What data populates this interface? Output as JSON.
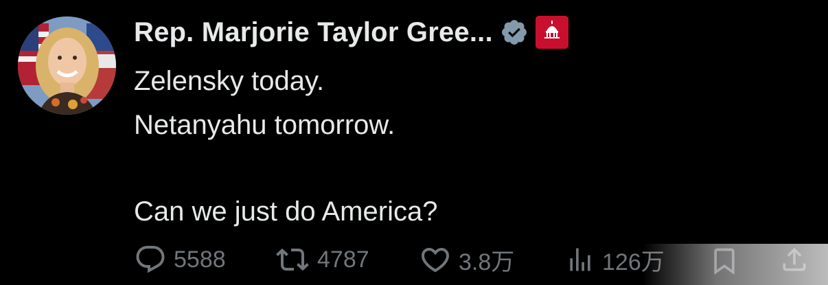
{
  "author": {
    "display_name": "Rep. Marjorie Taylor Gree...",
    "verified_icon": "verified-badge-icon",
    "affiliation_icon": "house-gop-badge-icon",
    "affiliation_text": "HOUSE GOP"
  },
  "tweet": {
    "lines": [
      "Zelensky today.",
      "Netanyahu tomorrow.",
      "",
      "Can we just do America?"
    ]
  },
  "actions": {
    "reply_count": "5588",
    "retweet_count": "4787",
    "like_count": "3.8万",
    "views_count": "126万"
  },
  "colors": {
    "background": "#000000",
    "text": "#e7e9ea",
    "muted": "#71767b",
    "verified": "#829aab",
    "affiliation": "#c8102e"
  }
}
